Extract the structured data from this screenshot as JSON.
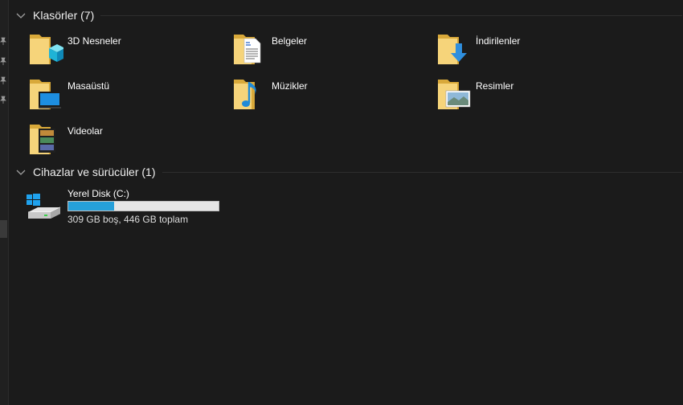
{
  "groups": {
    "folders": {
      "title": "Klasörler (7)"
    },
    "devices": {
      "title": "Cihazlar ve sürücüler (1)"
    }
  },
  "folders": [
    {
      "label": "3D Nesneler",
      "icon": "3d-objects-icon"
    },
    {
      "label": "Belgeler",
      "icon": "documents-icon"
    },
    {
      "label": "İndirilenler",
      "icon": "downloads-icon"
    },
    {
      "label": "Masaüstü",
      "icon": "desktop-icon"
    },
    {
      "label": "Müzikler",
      "icon": "music-icon"
    },
    {
      "label": "Resimler",
      "icon": "pictures-icon"
    },
    {
      "label": "Videolar",
      "icon": "videos-icon"
    }
  ],
  "drives": [
    {
      "name": "Yerel Disk (C:)",
      "space": "309 GB boş, 446 GB toplam",
      "used_fraction": 0.307,
      "icon": "windows-drive-icon"
    }
  ],
  "colors": {
    "background": "#191919",
    "folder": "#f0c75a",
    "accent": "#26a0da"
  }
}
